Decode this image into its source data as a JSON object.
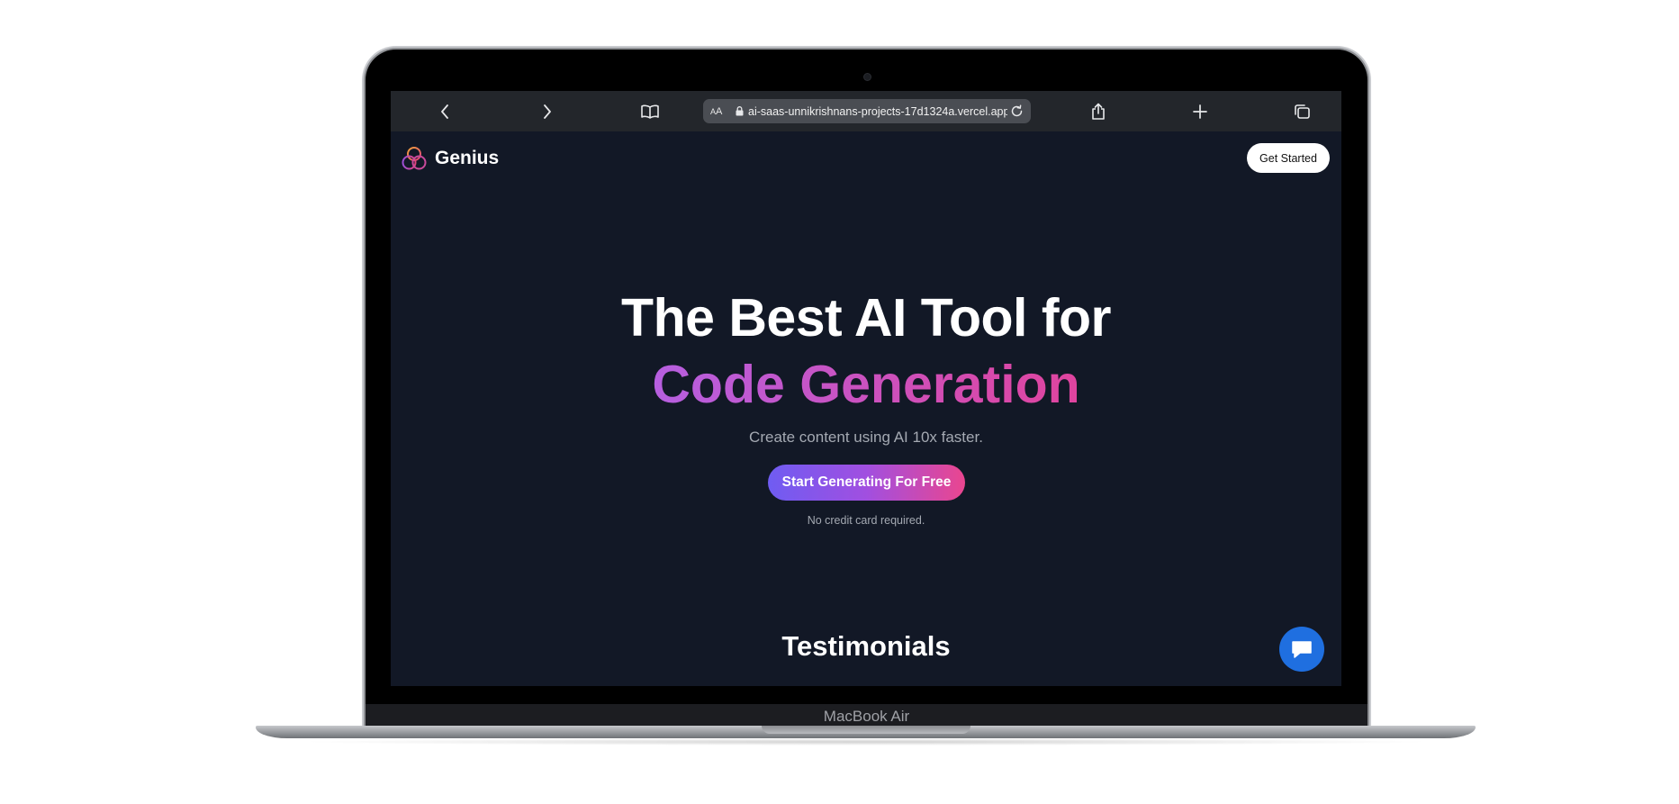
{
  "device": {
    "model_label": "MacBook Air"
  },
  "browser": {
    "back_icon": "chevron-left-icon",
    "forward_icon": "chevron-right-icon",
    "bookmarks_icon": "book-icon",
    "text_size_label": "AA",
    "url": "ai-saas-unnikrishnans-projects-17d1324a.vercel.app",
    "reload_icon": "reload-icon",
    "share_icon": "share-icon",
    "new_tab_icon": "plus-icon",
    "tabs_icon": "tabs-icon"
  },
  "navbar": {
    "brand": "Genius",
    "cta_label": "Get Started"
  },
  "hero": {
    "title_line1": "The Best AI Tool for",
    "title_line2": "Code Generation",
    "subtitle": "Create content using AI 10x faster.",
    "cta_label": "Start Generating For Free",
    "fineprint": "No credit card required."
  },
  "section": {
    "title": "Testimonials"
  },
  "colors": {
    "page_bg": "#121826",
    "accent_start": "#6f5cf2",
    "accent_end": "#ea468f",
    "chat_button": "#1f6fe0"
  }
}
